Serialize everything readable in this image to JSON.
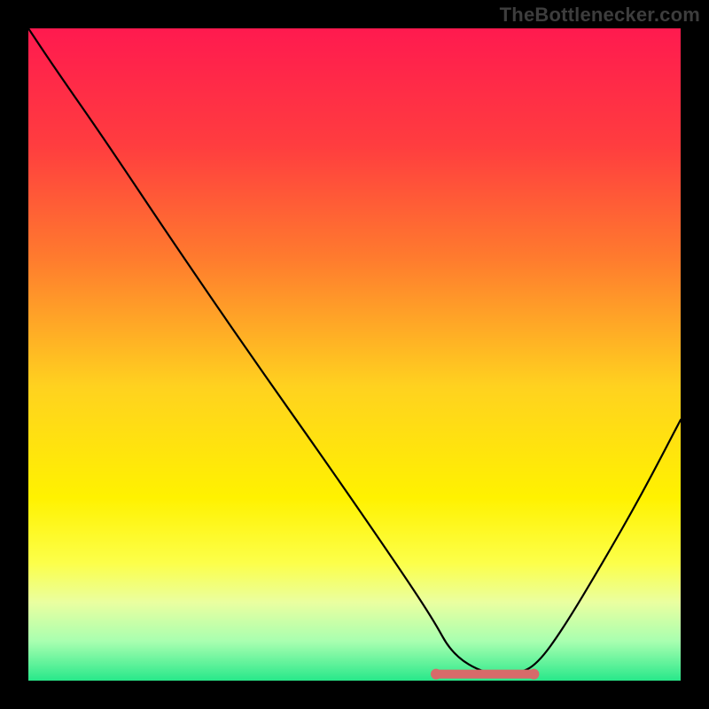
{
  "watermark": "TheBottlenecker.com",
  "chart_data": {
    "type": "line",
    "title": "",
    "xlabel": "",
    "ylabel": "",
    "xlim": [
      0,
      100
    ],
    "ylim": [
      0,
      100
    ],
    "grid": false,
    "background": {
      "type": "vertical-gradient",
      "stops": [
        {
          "pos": 0.0,
          "color": "#ff1a4f"
        },
        {
          "pos": 0.18,
          "color": "#ff3d3f"
        },
        {
          "pos": 0.35,
          "color": "#ff7a2e"
        },
        {
          "pos": 0.55,
          "color": "#ffd21f"
        },
        {
          "pos": 0.72,
          "color": "#fff200"
        },
        {
          "pos": 0.82,
          "color": "#fcff4a"
        },
        {
          "pos": 0.88,
          "color": "#eaffa0"
        },
        {
          "pos": 0.94,
          "color": "#a8ffb0"
        },
        {
          "pos": 1.0,
          "color": "#28e88a"
        }
      ]
    },
    "series": [
      {
        "name": "bottleneck-curve",
        "x": [
          0.0,
          4.0,
          12.0,
          22.0,
          34.0,
          46.0,
          56.0,
          62.0,
          65.0,
          70.0,
          75.0,
          78.0,
          82.0,
          88.0,
          94.0,
          100.0
        ],
        "y": [
          100.0,
          94.0,
          82.5,
          67.5,
          50.0,
          33.0,
          18.5,
          9.5,
          4.0,
          1.0,
          1.0,
          2.5,
          8.0,
          18.0,
          28.5,
          40.0
        ]
      }
    ],
    "highlight": {
      "name": "valley-highlight",
      "x": [
        62.5,
        77.5
      ],
      "y": [
        1.0,
        1.0
      ],
      "color": "#d76a6a"
    }
  }
}
